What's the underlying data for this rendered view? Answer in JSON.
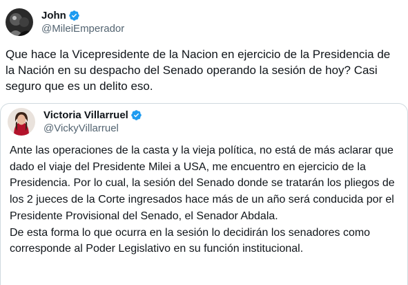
{
  "tweet": {
    "author": {
      "display_name": "John",
      "handle": "@MileiEmperador",
      "verified": true,
      "avatar_icon": "dark-profile-avatar"
    },
    "text": "Que hace la Vicepresidente de la Nacion en ejercicio de la Presidencia de la Nación en su despacho del Senado operando la sesión de hoy? Casi seguro que es un delito eso."
  },
  "quoted_tweet": {
    "author": {
      "display_name": "Victoria Villarruel",
      "handle": "@VickyVillarruel",
      "verified": true,
      "avatar_icon": "woman-profile-avatar"
    },
    "text": "Ante las operaciones de la casta y la vieja política, no está de más aclarar que dado el viaje del Presidente Milei a USA, me encuentro en ejercicio de la Presidencia. Por lo cual, la sesión del Senado donde se tratarán los pliegos de los 2 jueces de la Corte ingresados hace más de un año será conducida por el Presidente Provisional del Senado, el Senador Abdala.\nDe esta forma lo que ocurra en la sesión lo decidirán los senadores como corresponde al Poder Legislativo en su función institucional."
  },
  "colors": {
    "text": "#0f1419",
    "secondary": "#536471",
    "verified_badge": "#1d9bf0",
    "border": "#cfd9de"
  }
}
